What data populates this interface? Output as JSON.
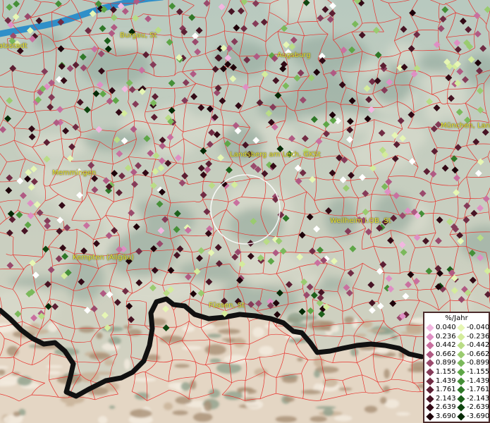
{
  "places": [
    {
      "name": "atsstadt"
    },
    {
      "name": "Burgau, St"
    },
    {
      "name": "Augsburg"
    },
    {
      "name": "München, Land"
    },
    {
      "name": "Landsberg am Lech, GKSt"
    },
    {
      "name": "Memmingen"
    },
    {
      "name": "Weilheim i.OB, St"
    },
    {
      "name": "Kempten (Allgäu)"
    },
    {
      "name": "Füssen, St"
    }
  ],
  "legend": {
    "title": "%/Jahr",
    "rows": [
      {
        "pos": "0.040",
        "neg": "-0.040",
        "pos_color": "#f2b6e0",
        "neg_color": "#e6f6b4"
      },
      {
        "pos": "0.236",
        "neg": "-0.236",
        "pos_color": "#df8fc4",
        "neg_color": "#d4ec9c"
      },
      {
        "pos": "0.442",
        "neg": "-0.442",
        "pos_color": "#c9709f",
        "neg_color": "#b9dc86"
      },
      {
        "pos": "0.662",
        "neg": "-0.662",
        "pos_color": "#b05a83",
        "neg_color": "#9acb70"
      },
      {
        "pos": "0.899",
        "neg": "-0.899",
        "pos_color": "#9a4a6c",
        "neg_color": "#7bb95b"
      },
      {
        "pos": "1.155",
        "neg": "-1.155",
        "pos_color": "#853b58",
        "neg_color": "#5ea647"
      },
      {
        "pos": "1.439",
        "neg": "-1.439",
        "pos_color": "#712c44",
        "neg_color": "#458f37"
      },
      {
        "pos": "1.761",
        "neg": "-1.761",
        "pos_color": "#5c1f33",
        "neg_color": "#2f7828"
      },
      {
        "pos": "2.143",
        "neg": "-2.143",
        "pos_color": "#471424",
        "neg_color": "#1d601b"
      },
      {
        "pos": "2.639",
        "neg": "-2.639",
        "pos_color": "#330a16",
        "neg_color": "#0f4610"
      },
      {
        "pos": "3.690",
        "neg": "-3.690",
        "pos_color": "#1e020a",
        "neg_color": "#052a06"
      }
    ]
  },
  "colors": {
    "boundary": "#e8332e",
    "lake": "#2f8fc9",
    "border_line": "#111111",
    "label": "#e8e23a",
    "circle": "#ffffff",
    "white_point": "#ffffff"
  }
}
